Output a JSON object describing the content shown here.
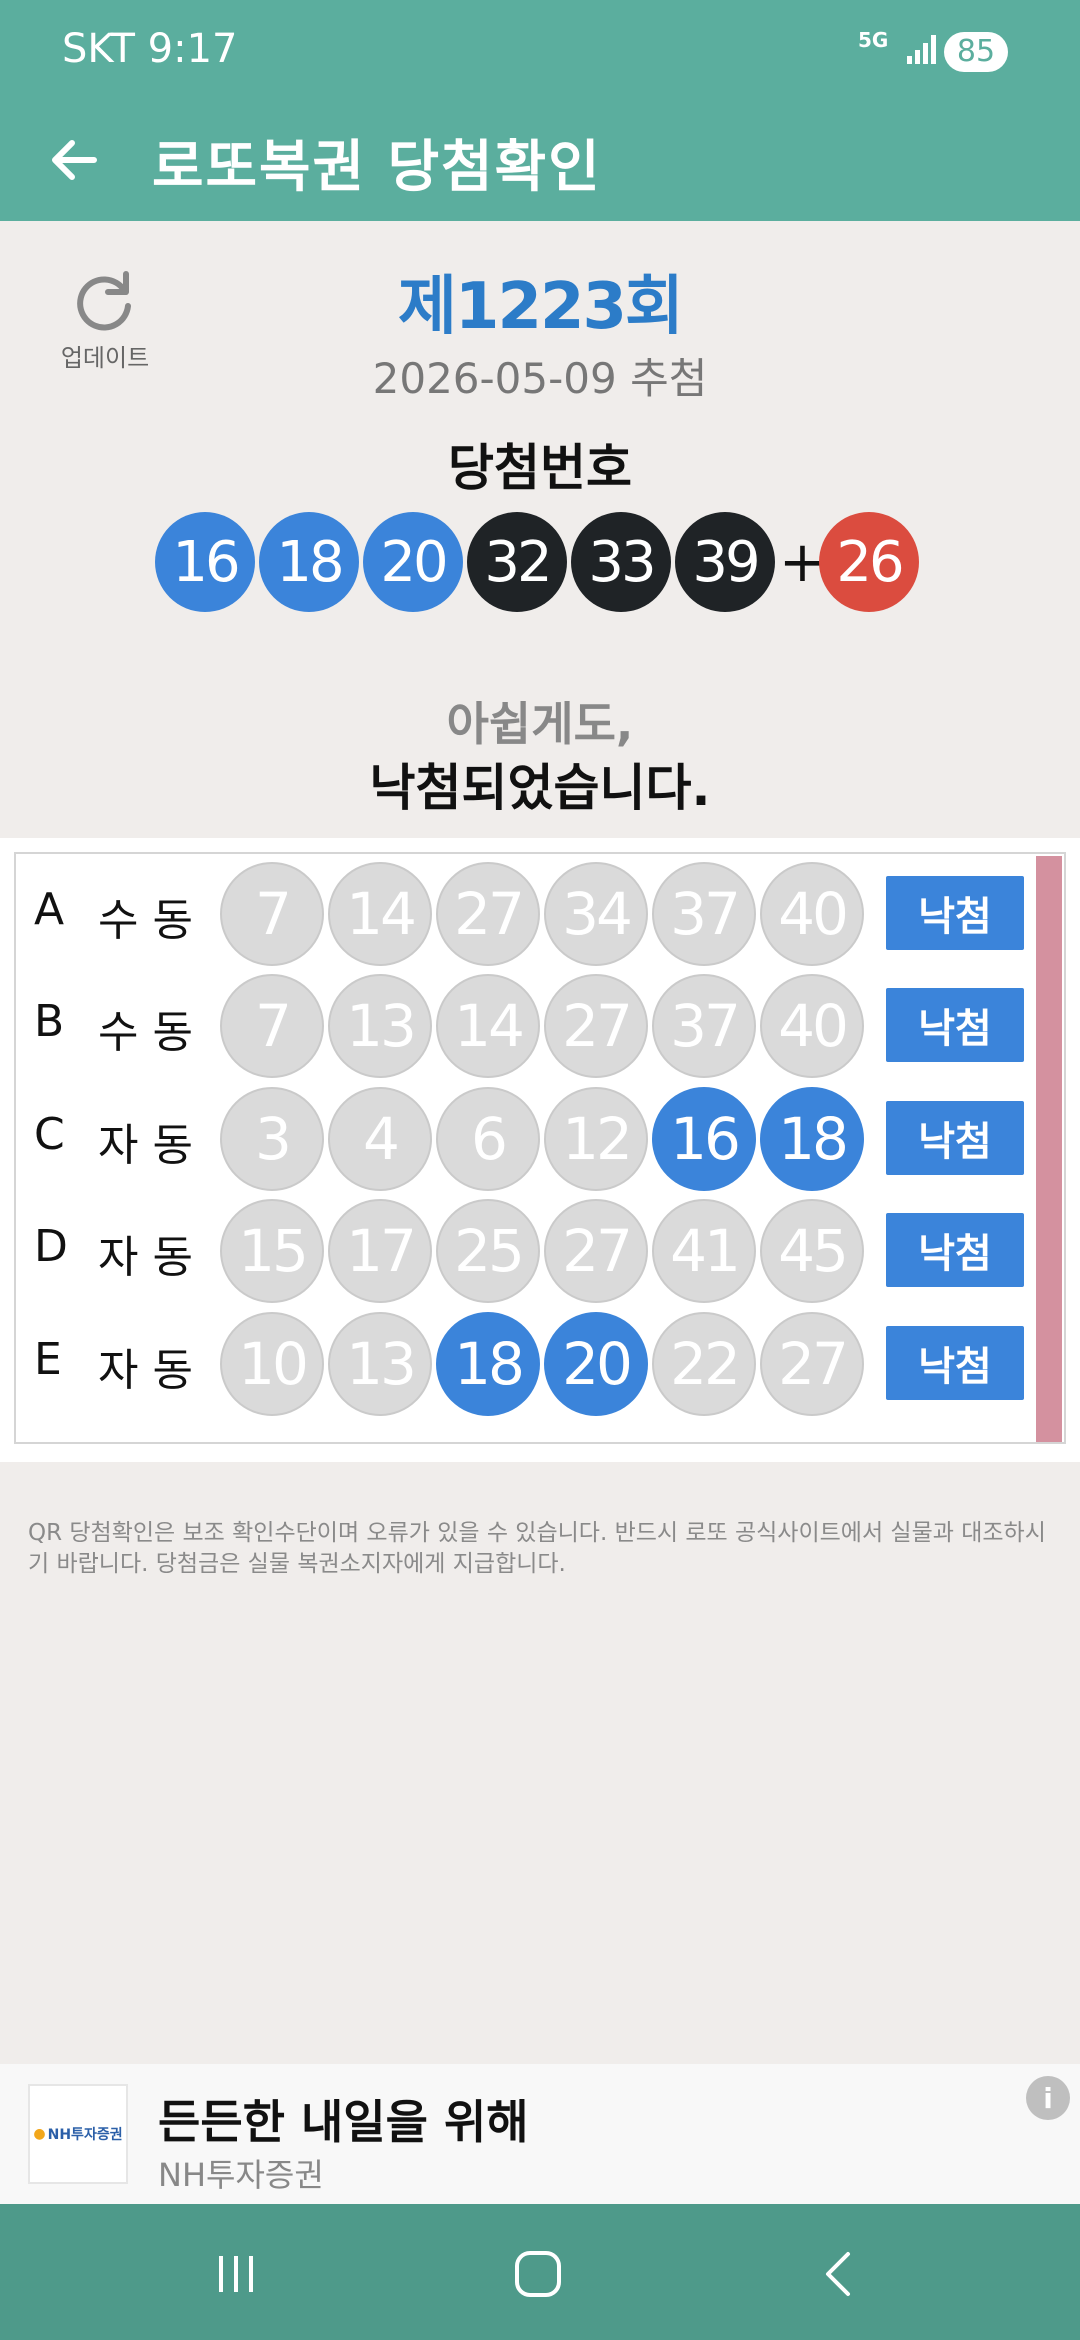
{
  "status_bar": {
    "carrier_time": "SKT 9:17",
    "network": "5G",
    "battery": "85"
  },
  "app_bar": {
    "title": "로또복권 당첨확인"
  },
  "update": {
    "label": "업데이트"
  },
  "draw": {
    "number_label": "제1223회",
    "date_label": "2026-05-09 추첨",
    "winning_title": "당첨번호",
    "winning_numbers": [
      "16",
      "18",
      "20",
      "32",
      "33",
      "39"
    ],
    "winning_colors": [
      "blue",
      "blue",
      "blue",
      "black",
      "black",
      "black"
    ],
    "plus": "+",
    "bonus": "26",
    "bonus_color": "red"
  },
  "result_message": {
    "line1": "아쉽게도,",
    "line2": "낙첨되었습니다."
  },
  "ticket": {
    "lines": [
      {
        "letter": "A",
        "mode": "수동",
        "numbers": [
          "7",
          "14",
          "27",
          "34",
          "37",
          "40"
        ],
        "hits": [
          false,
          false,
          false,
          false,
          false,
          false
        ],
        "result": "낙첨"
      },
      {
        "letter": "B",
        "mode": "수동",
        "numbers": [
          "7",
          "13",
          "14",
          "27",
          "37",
          "40"
        ],
        "hits": [
          false,
          false,
          false,
          false,
          false,
          false
        ],
        "result": "낙첨"
      },
      {
        "letter": "C",
        "mode": "자동",
        "numbers": [
          "3",
          "4",
          "6",
          "12",
          "16",
          "18"
        ],
        "hits": [
          false,
          false,
          false,
          false,
          true,
          true
        ],
        "result": "낙첨"
      },
      {
        "letter": "D",
        "mode": "자동",
        "numbers": [
          "15",
          "17",
          "25",
          "27",
          "41",
          "45"
        ],
        "hits": [
          false,
          false,
          false,
          false,
          false,
          false
        ],
        "result": "낙첨"
      },
      {
        "letter": "E",
        "mode": "자동",
        "numbers": [
          "10",
          "13",
          "18",
          "20",
          "22",
          "27"
        ],
        "hits": [
          false,
          false,
          true,
          true,
          false,
          false
        ],
        "result": "낙첨"
      }
    ]
  },
  "notice": "QR 당첨확인은 보조 확인수단이며 오류가 있을 수 있습니다. 반드시 로또 공식사이트에서 실물과 대조하시기 바랍니다. 당첨금은 실물 복권소지자에게 지급합니다.",
  "ad": {
    "logo_text": "NH투자증권",
    "headline": "든든한 내일을 위해",
    "advertiser": "NH투자증권",
    "info_icon": "i"
  },
  "colors": {
    "header": "#5BAE9E",
    "navbar": "#4E9A8A",
    "blue": "#3B84DA",
    "black": "#1F2326",
    "red": "#DB4C3F",
    "miss": "#DADADA",
    "ticket_edge": "#D4919F"
  }
}
